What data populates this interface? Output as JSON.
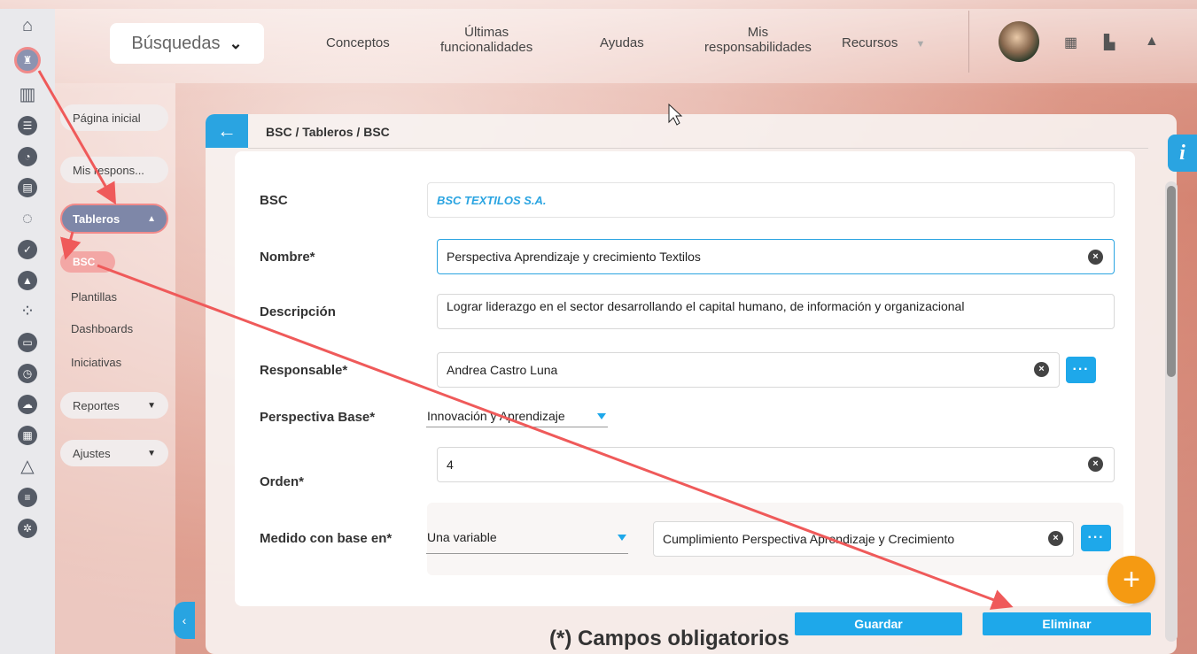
{
  "top_nav": {
    "search_label": "Búsquedas",
    "items": [
      {
        "line1": "Conceptos",
        "line2": ""
      },
      {
        "line1": "Últimas",
        "line2": "funcionalidades"
      },
      {
        "line1": "Ayudas",
        "line2": ""
      },
      {
        "line1": "Mis",
        "line2": "responsabilidades"
      },
      {
        "line1": "Recursos",
        "line2": ""
      }
    ]
  },
  "sidebar": {
    "pagina_inicial": "Página inicial",
    "mis_respons": "Mis respons...",
    "tableros": "Tableros",
    "sub_items": [
      "BSC",
      "Plantillas",
      "Dashboards",
      "Iniciativas"
    ],
    "reportes": "Reportes",
    "ajustes": "Ajustes"
  },
  "breadcrumb": "BSC / Tableros / BSC",
  "form": {
    "bsc_label": "BSC",
    "bsc_value": "BSC TEXTILOS S.A.",
    "nombre_label": "Nombre*",
    "nombre_value": "Perspectiva Aprendizaje y crecimiento Textilos",
    "descripcion_label": "Descripción",
    "descripcion_value": "Lograr liderazgo en el sector desarrollando el capital humano, de información y organizacional",
    "responsable_label": "Responsable*",
    "responsable_value": "Andrea Castro Luna",
    "perspectiva_label": "Perspectiva Base*",
    "perspectiva_value": "Innovación y Aprendizaje",
    "orden_label": "Orden*",
    "orden_value": "4",
    "medido_label": "Medido con base en*",
    "medido_value": "Una variable",
    "variable_value": "Cumplimiento Perspectiva Aprendizaje y Crecimiento"
  },
  "buttons": {
    "guardar": "Guardar",
    "eliminar": "Eliminar",
    "more": "···",
    "fab": "+",
    "info": "i"
  },
  "footer_note": "(*) Campos obligatorios",
  "colors": {
    "accent": "#1ea8ea",
    "annotation_arrow": "#ef5a5a",
    "fab": "#f59a12"
  }
}
